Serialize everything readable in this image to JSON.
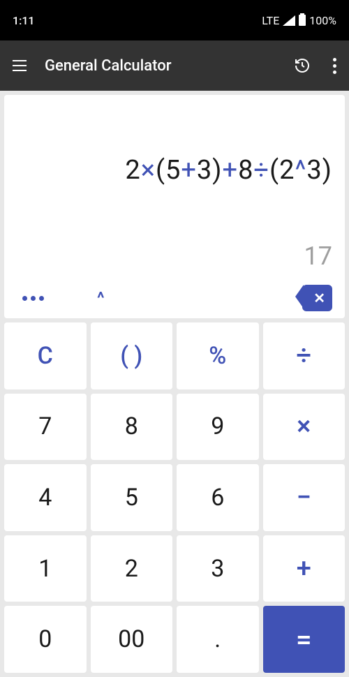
{
  "status": {
    "time": "1:11",
    "network": "LTE",
    "battery": "100%"
  },
  "appbar": {
    "title": "General Calculator"
  },
  "display": {
    "expression_tokens": [
      {
        "t": "2",
        "op": false
      },
      {
        "t": "×",
        "op": true
      },
      {
        "t": "(5",
        "op": false
      },
      {
        "t": "+",
        "op": true
      },
      {
        "t": "3)",
        "op": false
      },
      {
        "t": "+",
        "op": true
      },
      {
        "t": "8",
        "op": false
      },
      {
        "t": "÷",
        "op": true
      },
      {
        "t": "(2",
        "op": false
      },
      {
        "t": "^",
        "op": true
      },
      {
        "t": "3)",
        "op": false
      }
    ],
    "result": "17",
    "caret_label": "^"
  },
  "keys": {
    "clear": "C",
    "paren": "( )",
    "percent": "%",
    "divide": "÷",
    "k7": "7",
    "k8": "8",
    "k9": "9",
    "multiply": "×",
    "k4": "4",
    "k5": "5",
    "k6": "6",
    "minus": "−",
    "k1": "1",
    "k2": "2",
    "k3": "3",
    "plus": "+",
    "k0": "0",
    "k00": "00",
    "dot": ".",
    "equals": "="
  }
}
